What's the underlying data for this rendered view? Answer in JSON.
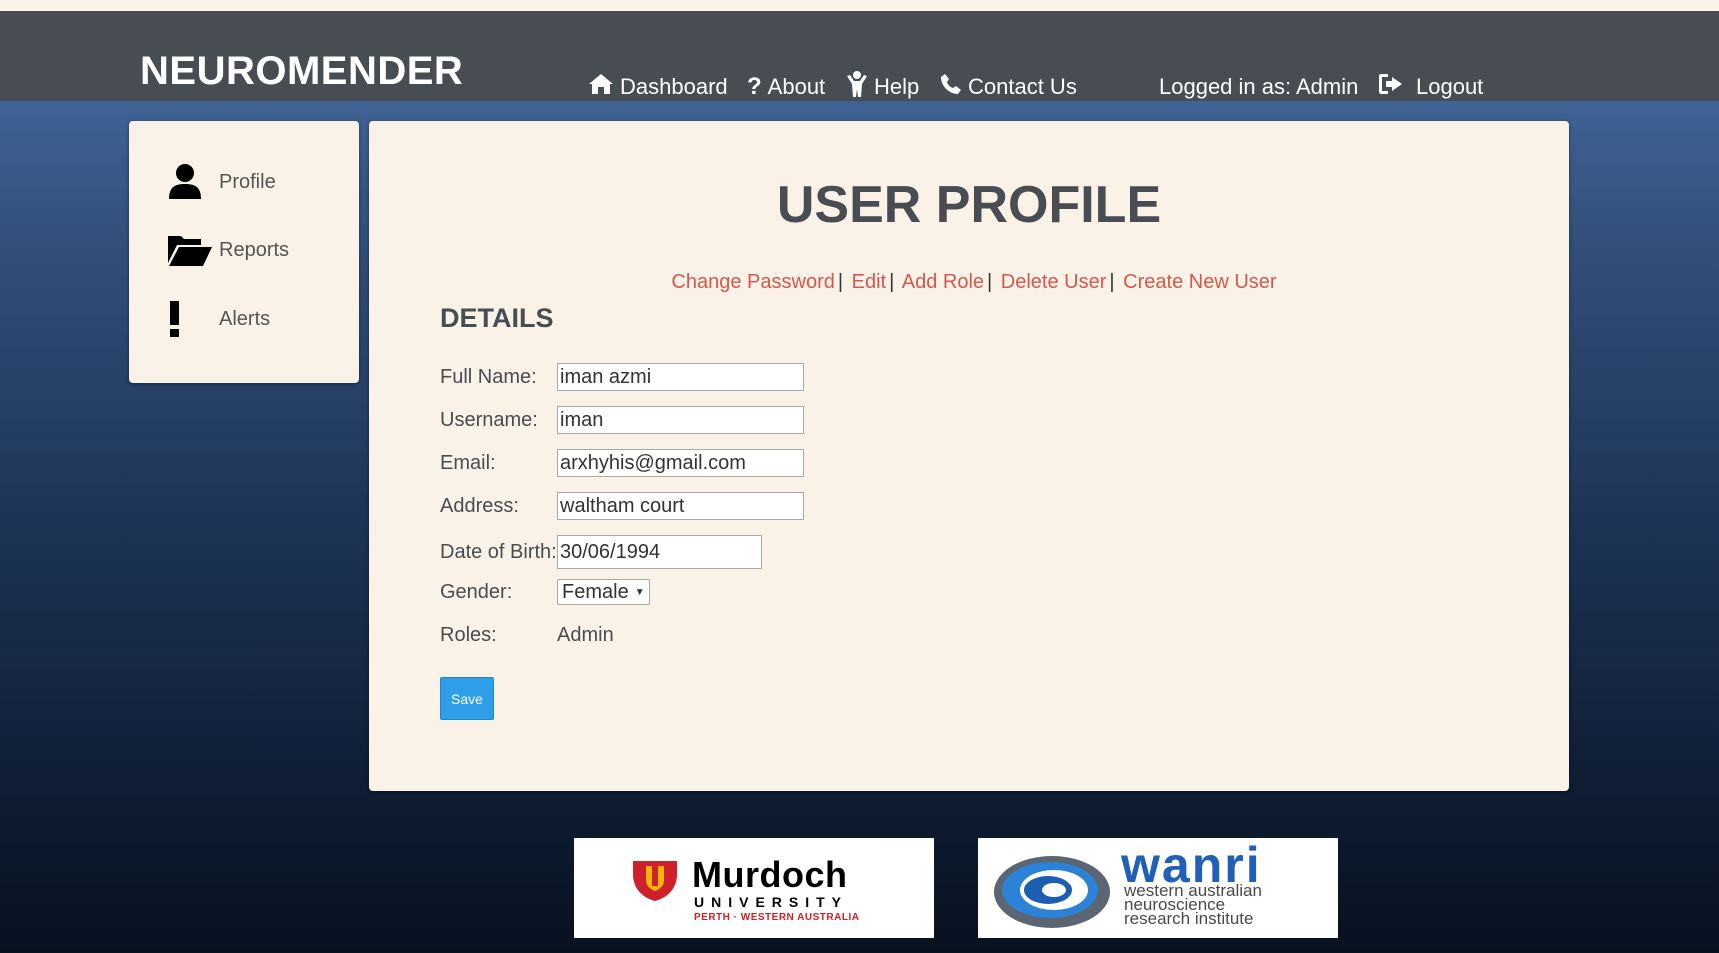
{
  "header": {
    "brand": "NEUROMENDER",
    "nav": [
      {
        "label": "Dashboard",
        "icon": "home-icon"
      },
      {
        "label": "About",
        "icon": "question-icon"
      },
      {
        "label": "Help",
        "icon": "help-person-icon"
      },
      {
        "label": "Contact Us",
        "icon": "phone-icon"
      }
    ],
    "logged_in": "Logged in as: Admin",
    "logout": "Logout"
  },
  "sidebar": {
    "items": [
      {
        "label": "Profile",
        "icon": "user-icon"
      },
      {
        "label": "Reports",
        "icon": "folder-open-icon"
      },
      {
        "label": "Alerts",
        "icon": "exclamation-icon"
      }
    ]
  },
  "main": {
    "title": "USER PROFILE",
    "actions": [
      "Change Password",
      "Edit",
      "Add Role",
      "Delete User",
      "Create New User"
    ],
    "separator": "|",
    "details_heading": "DETAILS",
    "fields": {
      "full_name": {
        "label": "Full Name:",
        "value": "iman azmi"
      },
      "username": {
        "label": "Username:",
        "value": "iman"
      },
      "email": {
        "label": "Email:",
        "value": "arxhyhis@gmail.com"
      },
      "address": {
        "label": "Address:",
        "value": "waltham court"
      },
      "dob": {
        "label": "Date of Birth:",
        "value": "30/06/1994"
      },
      "gender": {
        "label": "Gender:",
        "value": "Female"
      },
      "roles": {
        "label": "Roles:",
        "value": "Admin"
      }
    },
    "save_label": "Save"
  },
  "footer": {
    "murdoch": {
      "name": "Murdoch",
      "sub": "UNIVERSITY",
      "location": "PERTH · WESTERN AUSTRALIA"
    },
    "wanri": {
      "name": "wanri",
      "line1": "western australian",
      "line2": "neuroscience",
      "line3": "research institute"
    }
  },
  "colors": {
    "navbar": "#474d52",
    "panel": "#fbf2e7",
    "link": "#d5584e",
    "save_button": "#2f9ee8"
  }
}
